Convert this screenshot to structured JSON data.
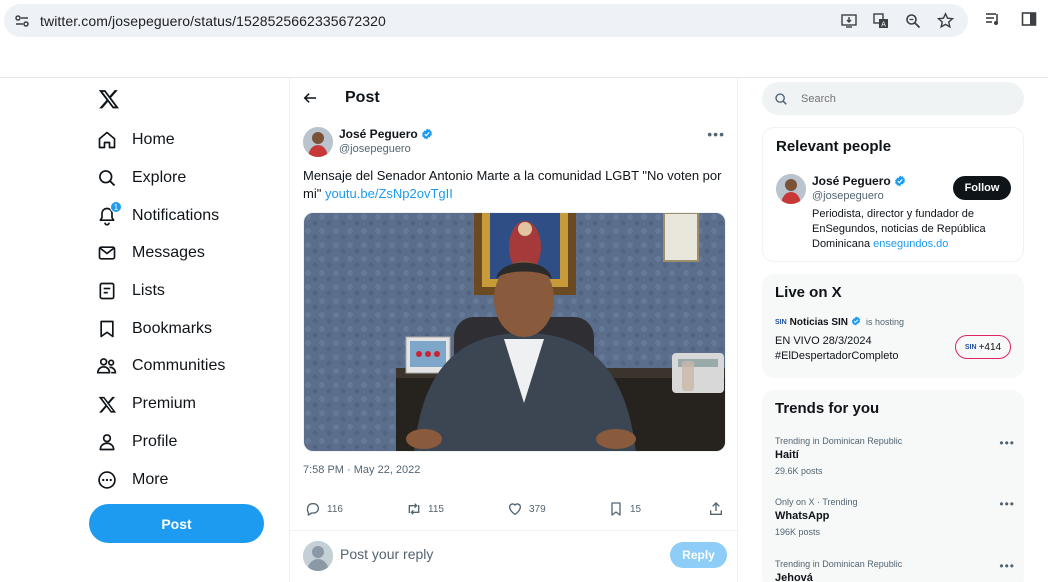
{
  "browser": {
    "url": "twitter.com/josepeguero/status/1528525662335672320"
  },
  "nav": {
    "items": [
      {
        "label": "Home",
        "icon": "home-icon"
      },
      {
        "label": "Explore",
        "icon": "search-icon"
      },
      {
        "label": "Notifications",
        "icon": "bell-icon",
        "badge": "1"
      },
      {
        "label": "Messages",
        "icon": "envelope-icon"
      },
      {
        "label": "Lists",
        "icon": "list-icon"
      },
      {
        "label": "Bookmarks",
        "icon": "bookmark-icon"
      },
      {
        "label": "Communities",
        "icon": "communities-icon"
      },
      {
        "label": "Premium",
        "icon": "x-logo-icon"
      },
      {
        "label": "Profile",
        "icon": "person-icon"
      },
      {
        "label": "More",
        "icon": "more-circle-icon"
      }
    ],
    "post_button": "Post"
  },
  "main": {
    "header_title": "Post",
    "author": {
      "name": "José Peguero",
      "handle": "@josepeguero"
    },
    "text": "Mensaje del Senador Antonio Marte a la comunidad LGBT \"No voten por mi\" ",
    "link": "youtu.be/ZsNp2ovTgII",
    "timestamp": "7:58 PM · May 22, 2022",
    "stats": {
      "replies": "116",
      "reposts": "115",
      "likes": "379",
      "bookmarks": "15"
    },
    "reply_placeholder": "Post your reply",
    "reply_button": "Reply"
  },
  "right": {
    "search_placeholder": "Search",
    "relevant": {
      "title": "Relevant people",
      "name": "José Peguero",
      "handle": "@josepeguero",
      "follow": "Follow",
      "bio": "Periodista, director y fundador de EnSegundos, noticias de República Dominicana ",
      "bio_link": "ensegundos.do"
    },
    "live": {
      "title": "Live on X",
      "host": "Noticias SIN",
      "host_logo": "SIN",
      "hosting": "is hosting",
      "line1": "EN VIVO 28/3/2024",
      "line2": "#ElDespertadorCompleto",
      "count": "+414",
      "count_logo": "SIN"
    },
    "trends": {
      "title": "Trends for you",
      "items": [
        {
          "context": "Trending in Dominican Republic",
          "name": "Haití",
          "count": "29.6K posts"
        },
        {
          "context": "Only on X · Trending",
          "name": "WhatsApp",
          "count": "196K posts"
        },
        {
          "context": "Trending in Dominican Republic",
          "name": "Jehová",
          "count": ""
        }
      ]
    }
  }
}
